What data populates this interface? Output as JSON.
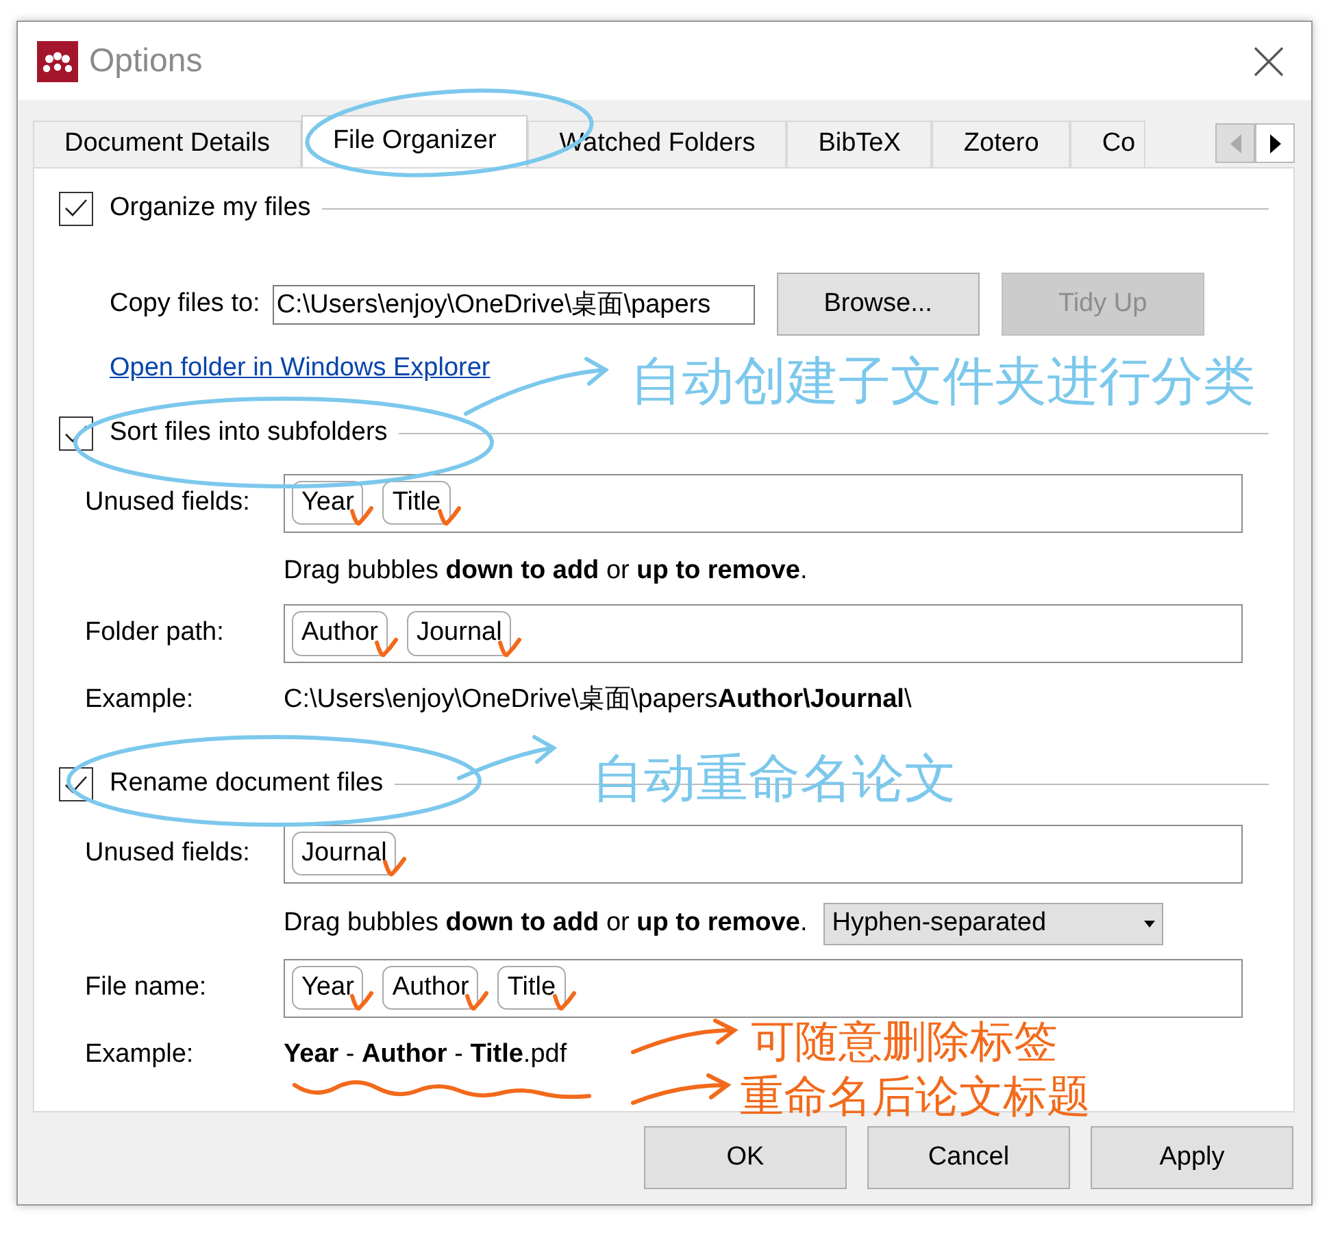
{
  "window": {
    "title": "Options"
  },
  "tabs": [
    {
      "label": "Document Details",
      "selected": false
    },
    {
      "label": "File Organizer",
      "selected": true
    },
    {
      "label": "Watched Folders",
      "selected": false
    },
    {
      "label": "BibTeX",
      "selected": false
    },
    {
      "label": "Zotero",
      "selected": false
    },
    {
      "label": "Co",
      "selected": false
    }
  ],
  "sections": [
    {
      "kind": "organize",
      "label": "Organize my files",
      "checked": true,
      "copy_label": "Copy files to:",
      "path": "C:\\Users\\enjoy\\OneDrive\\桌面\\papers",
      "browse": "Browse...",
      "tidy": {
        "label": "Tidy Up",
        "disabled": true
      },
      "link": "Open folder in Windows Explorer"
    },
    {
      "kind": "fields",
      "label": "Sort files into subfolders",
      "checked": true,
      "rows": [
        {
          "kind": "bubbles",
          "label": "Unused fields:",
          "bubbles": [
            {
              "label": "Year",
              "ticked": true
            },
            {
              "label": "Title",
              "ticked": true
            }
          ]
        },
        {
          "kind": "hint",
          "text": "Drag bubbles **down to add** or **up to remove**."
        },
        {
          "kind": "bubbles",
          "label": "Folder path:",
          "bubbles": [
            {
              "label": "Author",
              "ticked": true
            },
            {
              "label": "Journal",
              "ticked": true
            }
          ]
        },
        {
          "kind": "example",
          "label": "Example:",
          "text": "C:\\Users\\enjoy\\OneDrive\\桌面\\papers**Author\\Journal**\\"
        }
      ]
    },
    {
      "kind": "fields",
      "label": "Rename document files",
      "checked": true,
      "rows": [
        {
          "kind": "bubbles",
          "label": "Unused fields:",
          "bubbles": [
            {
              "label": "Journal",
              "ticked": true
            }
          ]
        },
        {
          "kind": "hint",
          "text": "Drag bubbles **down to add** or **up to remove**.",
          "select": "Hyphen-separated"
        },
        {
          "kind": "bubbles",
          "label": "File name:",
          "bubbles": [
            {
              "label": "Year",
              "ticked": true
            },
            {
              "label": "Author",
              "ticked": true
            },
            {
              "label": "Title",
              "ticked": true
            }
          ]
        },
        {
          "kind": "example",
          "label": "Example:",
          "text": "**Year** - **Author** - **Title**.pdf"
        }
      ]
    }
  ],
  "buttons": [
    {
      "label": "OK"
    },
    {
      "label": "Cancel"
    },
    {
      "label": "Apply"
    }
  ],
  "annotations": [
    {
      "text": "自动创建子文件夹进行分类",
      "color": "#7cc8ec"
    },
    {
      "text": "自动重命名论文",
      "color": "#7cc8ec"
    },
    {
      "text": "可随意删除标签",
      "color": "#f26a1b"
    },
    {
      "text": "重命名后论文标题",
      "color": "#f26a1b"
    }
  ]
}
